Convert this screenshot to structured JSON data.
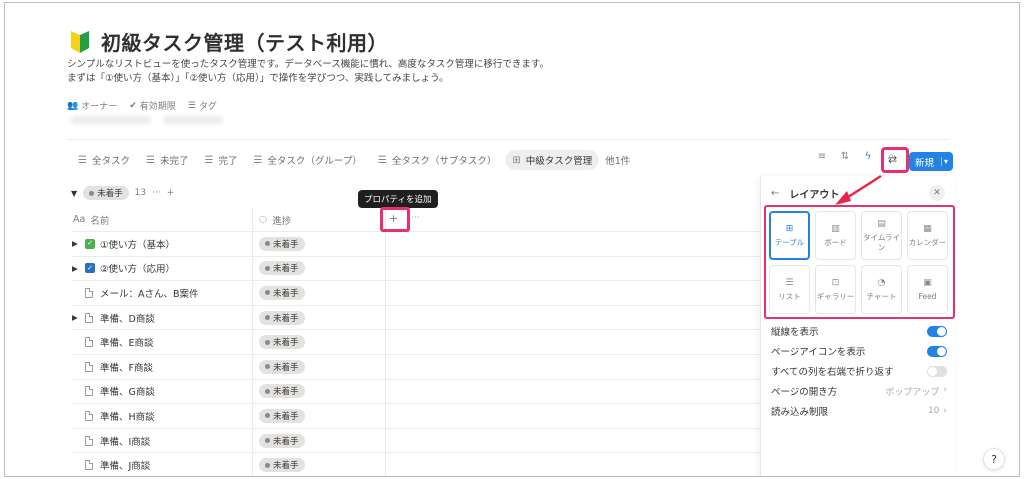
{
  "page": {
    "title": "初級タスク管理（テスト利用）",
    "description_1": "シンプルなリストビューを使ったタスク管理です。データベース機能に慣れ、高度なタスク管理に移行できます。",
    "description_2": "まずは「①使い方（基本）」「②使い方（応用）」で操作を学びつつ、実践してみましょう。"
  },
  "properties": [
    {
      "icon": "people-icon",
      "label": "オーナー"
    },
    {
      "icon": "check-circle-icon",
      "label": "有効期限"
    },
    {
      "icon": "list-icon",
      "label": "タグ"
    }
  ],
  "tabs": [
    {
      "label": "全タスク",
      "active": false
    },
    {
      "label": "未完了",
      "active": false
    },
    {
      "label": "完了",
      "active": false
    },
    {
      "label": "全タスク（グループ）",
      "active": false
    },
    {
      "label": "全タスク（サブタスク）",
      "active": false
    },
    {
      "label": "中級タスク管理",
      "active": true
    }
  ],
  "tabs_more": "他1件",
  "toolbar": {
    "new_label": "新規"
  },
  "group": {
    "label": "未着手",
    "count": "13",
    "more": "···",
    "add": "+"
  },
  "tooltip": "プロパティを追加",
  "table": {
    "columns": [
      {
        "label": "名前",
        "icon": "Aa"
      },
      {
        "label": "進捗",
        "icon": "progress-icon"
      }
    ],
    "rows": [
      {
        "name": "①使い方（基本）",
        "status": "未着手",
        "caret": true,
        "icon": "check-green"
      },
      {
        "name": "②使い方（応用）",
        "status": "未着手",
        "caret": true,
        "icon": "check-blue"
      },
      {
        "name": "メール：Aさん、B案件",
        "status": "未着手",
        "caret": false,
        "icon": "doc"
      },
      {
        "name": "準備、D商談",
        "status": "未着手",
        "caret": true,
        "icon": "doc"
      },
      {
        "name": "準備、E商談",
        "status": "未着手",
        "caret": false,
        "icon": "doc"
      },
      {
        "name": "準備、F商談",
        "status": "未着手",
        "caret": false,
        "icon": "doc"
      },
      {
        "name": "準備、G商談",
        "status": "未着手",
        "caret": false,
        "icon": "doc"
      },
      {
        "name": "準備、H商談",
        "status": "未着手",
        "caret": false,
        "icon": "doc"
      },
      {
        "name": "準備、I商談",
        "status": "未着手",
        "caret": false,
        "icon": "doc"
      },
      {
        "name": "準備、J商談",
        "status": "未着手",
        "caret": false,
        "icon": "doc"
      }
    ]
  },
  "layout_panel": {
    "title": "レイアウト",
    "layouts": [
      {
        "label": "テーブル",
        "icon": "table-icon",
        "selected": true
      },
      {
        "label": "ボード",
        "icon": "board-icon",
        "selected": false
      },
      {
        "label": "タイムライン",
        "icon": "timeline-icon",
        "selected": false
      },
      {
        "label": "カレンダー",
        "icon": "calendar-icon",
        "selected": false
      },
      {
        "label": "リスト",
        "icon": "list-icon",
        "selected": false
      },
      {
        "label": "ギャラリー",
        "icon": "gallery-icon",
        "selected": false
      },
      {
        "label": "チャート",
        "icon": "chart-icon",
        "selected": false
      },
      {
        "label": "Feed",
        "icon": "feed-icon",
        "selected": false
      }
    ],
    "options": [
      {
        "label": "縦線を表示",
        "type": "toggle",
        "on": true
      },
      {
        "label": "ページアイコンを表示",
        "type": "toggle",
        "on": true
      },
      {
        "label": "すべての列を右端で折り返す",
        "type": "toggle",
        "on": false
      },
      {
        "label": "ページの開き方",
        "type": "value",
        "value": "ポップアップ"
      },
      {
        "label": "読み込み制限",
        "type": "value",
        "value": "10"
      }
    ]
  },
  "colors": {
    "accent": "#2383e2",
    "highlight": "#e8306a"
  }
}
